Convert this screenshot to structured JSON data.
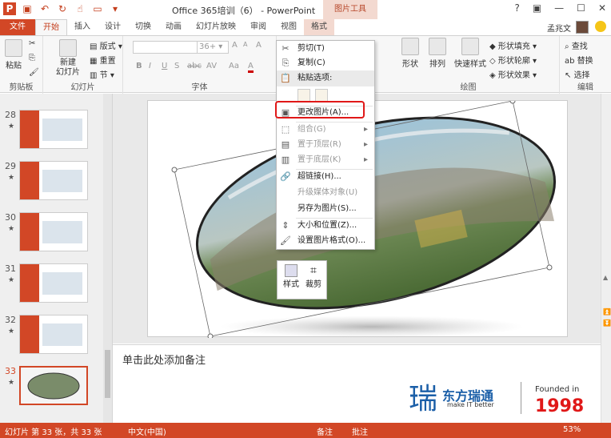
{
  "titlebar": {
    "title": "Office 365培训（6） - PowerPoint",
    "context_tab_group": "图片工具",
    "user_name": "孟兆文",
    "help": "?",
    "qat_icons": [
      "powerpoint-icon",
      "save-icon",
      "undo-icon",
      "redo-icon",
      "touch-mode-icon",
      "start-from-beginning-icon",
      "customize-icon"
    ]
  },
  "tabs": [
    "文件",
    "开始",
    "插入",
    "设计",
    "切换",
    "动画",
    "幻灯片放映",
    "审阅",
    "视图",
    "格式"
  ],
  "ribbon": {
    "clipboard": {
      "label": "剪贴板",
      "paste": "粘贴"
    },
    "slides": {
      "label": "幻灯片",
      "new_slide_line1": "新建",
      "new_slide_line2": "幻灯片",
      "layout": "版式",
      "reset": "重置",
      "section": "节"
    },
    "font": {
      "label": "字体",
      "size": "36+",
      "bold": "B",
      "italic": "I",
      "underline": "U",
      "strike": "S",
      "shadow": "abc",
      "spacing": "AV",
      "case": "Aa",
      "grow": "A",
      "shrink": "A",
      "clear": "A",
      "color": "A"
    },
    "drawing": {
      "label": "绘图",
      "shapes": "形状",
      "arrange": "排列",
      "quick_styles": "快速样式",
      "fill": "形状填充",
      "outline": "形状轮廓",
      "effects": "形状效果"
    },
    "editing": {
      "label": "编辑",
      "find": "查找",
      "replace": "替换",
      "select": "选择"
    }
  },
  "slides_panel": {
    "items": [
      {
        "num": "28",
        "star": "★"
      },
      {
        "num": "29",
        "star": "★"
      },
      {
        "num": "30",
        "star": "★"
      },
      {
        "num": "31",
        "star": "★"
      },
      {
        "num": "32",
        "star": "★"
      },
      {
        "num": "33",
        "star": "★"
      }
    ]
  },
  "context_menu": {
    "cut": "剪切(T)",
    "copy": "复制(C)",
    "paste_options": "粘贴选项:",
    "change_picture": "更改图片(A)...",
    "group": "组合(G)",
    "bring_front": "置于顶层(R)",
    "send_back": "置于底层(K)",
    "hyperlink": "超链接(H)...",
    "upgrade_media": "升级媒体对象(U)",
    "save_as_picture": "另存为图片(S)...",
    "size_position": "大小和位置(Z)...",
    "format_picture": "设置图片格式(O)..."
  },
  "mini_toolbar": {
    "style": "样式",
    "crop": "裁剪"
  },
  "notes": {
    "placeholder": "单击此处添加备注"
  },
  "logo": {
    "cn": "东方瑞通",
    "en": "make IT better",
    "founded": "Founded in",
    "year": "1998",
    "mark": "瑞"
  },
  "status": {
    "slide_info": "幻灯片 第 33 张，共 33 张",
    "language": "中文(中国)",
    "notes": "备注",
    "comments": "批注",
    "zoom": "53%"
  },
  "colors": {
    "accent": "#d24726",
    "highlight": "#e01818"
  }
}
